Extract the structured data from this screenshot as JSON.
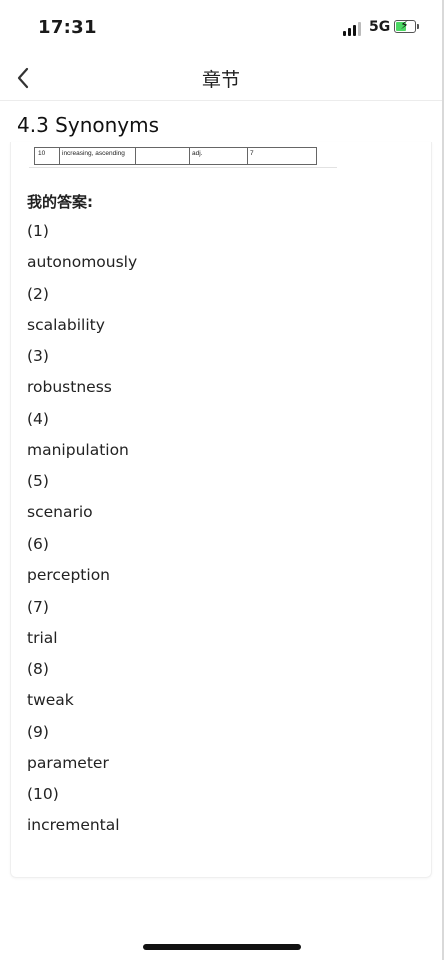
{
  "status_bar": {
    "time": "17:31",
    "network": "5G",
    "battery_level": 0.6
  },
  "nav": {
    "title": "章节"
  },
  "section": {
    "title": "4.3 Synonyms"
  },
  "table_snippet": {
    "num": "10",
    "words": "increasing, ascending",
    "pos": "adj.",
    "answer_ref": "7"
  },
  "answers": {
    "heading": "我的答案:",
    "items": [
      {
        "num": "(1)",
        "text": "autonomously"
      },
      {
        "num": "(2)",
        "text": "scalability"
      },
      {
        "num": "(3)",
        "text": "robustness"
      },
      {
        "num": "(4)",
        "text": "manipulation"
      },
      {
        "num": "(5)",
        "text": "scenario"
      },
      {
        "num": "(6)",
        "text": "perception"
      },
      {
        "num": "(7)",
        "text": "trial"
      },
      {
        "num": "(8)",
        "text": "tweak"
      },
      {
        "num": "(9)",
        "text": "parameter"
      },
      {
        "num": "(10)",
        "text": "incremental"
      }
    ]
  },
  "icons": {
    "back": "chevron-left-icon",
    "signal": "signal-bars-icon",
    "battery": "battery-charging-icon"
  },
  "colors": {
    "battery_fill": "#4cd964",
    "text": "#222222",
    "divider": "#ececec"
  }
}
